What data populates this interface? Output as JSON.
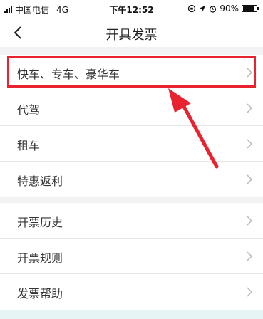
{
  "status_bar": {
    "carrier": "中国电信",
    "network": "4G",
    "time": "下午12:52",
    "battery_percent": "90%",
    "battery_level": 0.9
  },
  "nav": {
    "title": "开具发票",
    "back_icon": "chevron-left-icon"
  },
  "menu_groups": [
    {
      "items": [
        {
          "label": "快车、专车、豪华车"
        },
        {
          "label": "代驾"
        },
        {
          "label": "租车"
        },
        {
          "label": "特惠返利"
        }
      ]
    },
    {
      "items": [
        {
          "label": "开票历史"
        },
        {
          "label": "开票规则"
        },
        {
          "label": "发票帮助"
        }
      ]
    }
  ],
  "annotation": {
    "highlight_color": "#e8232f"
  },
  "colors": {
    "background": "#f2f2f4",
    "row_text": "#333333",
    "chevron": "#b8b8b8"
  }
}
